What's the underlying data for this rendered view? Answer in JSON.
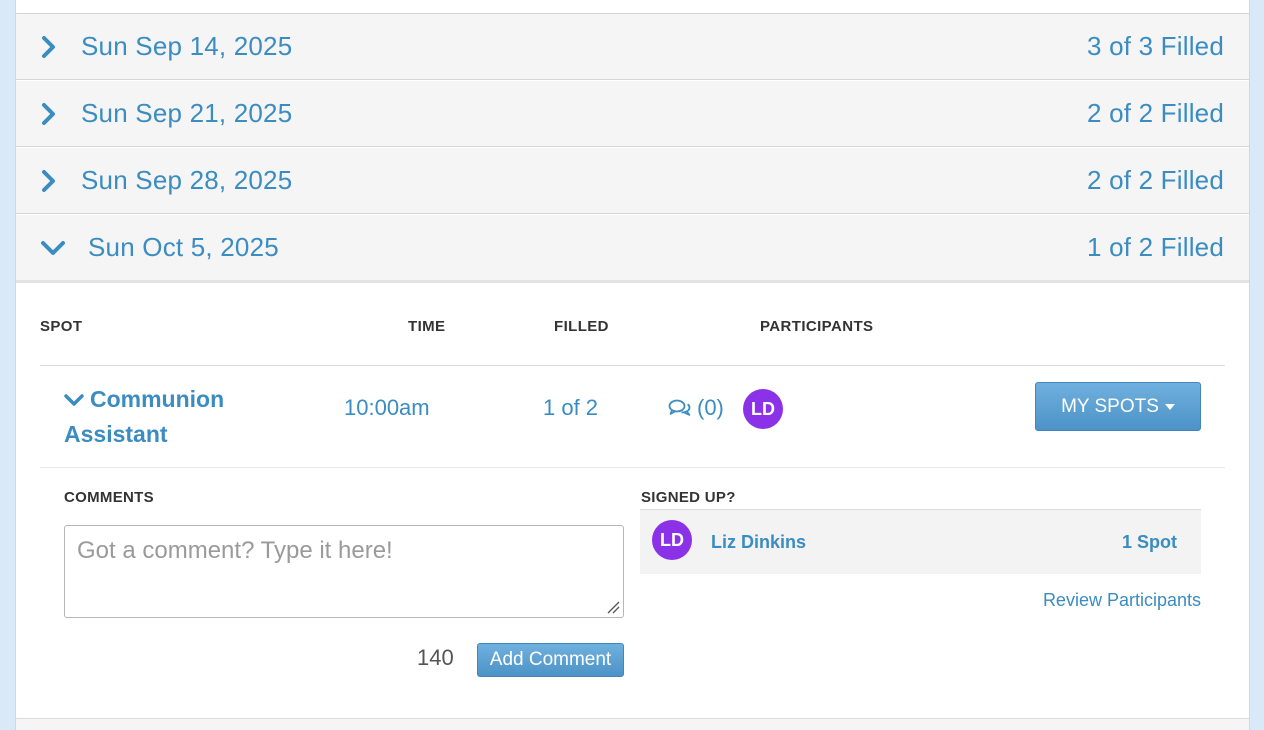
{
  "dates": [
    {
      "date": "Sun Sep 14, 2025",
      "filled": "3 of 3 Filled",
      "expanded": false
    },
    {
      "date": "Sun Sep 21, 2025",
      "filled": "2 of 2 Filled",
      "expanded": false
    },
    {
      "date": "Sun Sep 28, 2025",
      "filled": "2 of 2 Filled",
      "expanded": false
    },
    {
      "date": "Sun Oct 5, 2025",
      "filled": "1 of 2 Filled",
      "expanded": true
    }
  ],
  "table_headers": {
    "spot": "SPOT",
    "time": "TIME",
    "filled": "FILLED",
    "participants": "PARTICIPANTS"
  },
  "slot": {
    "name": "Communion Assistant",
    "time": "10:00am",
    "filled": "1 of 2",
    "comment_count": "(0)",
    "participant_initials": "LD",
    "my_spots_label": "MY SPOTS"
  },
  "comments": {
    "header": "COMMENTS",
    "placeholder": "Got a comment? Type it here!",
    "char_counter": "140",
    "add_button": "Add Comment"
  },
  "signed_up": {
    "header": "SIGNED UP?",
    "initials": "LD",
    "name": "Liz Dinkins",
    "spots": "1 Spot",
    "review_link": "Review Participants"
  },
  "colors": {
    "accent": "#3a8cc1",
    "avatar": "#8b31e8",
    "button": "#5a9fd1"
  }
}
